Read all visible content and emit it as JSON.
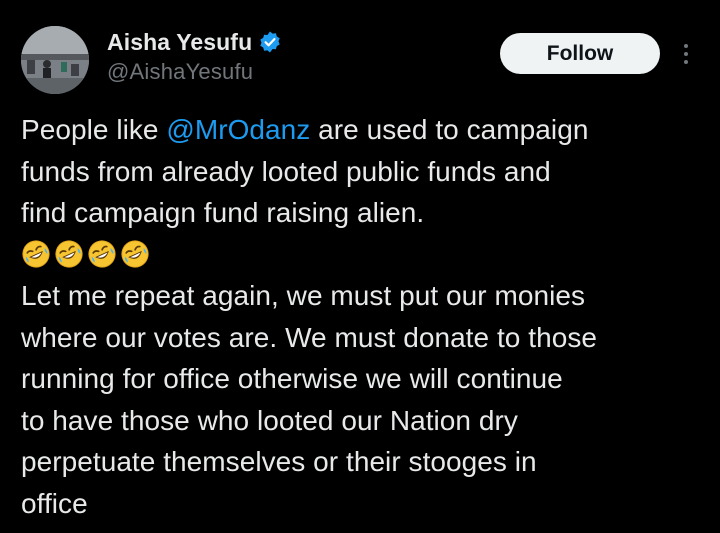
{
  "author": {
    "display_name": "Aisha Yesufu",
    "handle": "@AishaYesufu",
    "verified": true,
    "verified_icon": "verified-badge-icon"
  },
  "actions": {
    "follow_label": "Follow",
    "more_icon": "more-vertical-icon"
  },
  "tweet": {
    "line1_prefix": "People like ",
    "mention": "@MrOdanz",
    "line1_suffix": " are used to campaign",
    "line2": "funds from already looted public funds and",
    "line3": "find campaign fund raising alien.",
    "emoji_name": "rolling-on-the-floor-laughing",
    "emoji_count": 4,
    "line4": "Let me repeat again, we must put our monies",
    "line5": "where our votes are. We must donate to those",
    "line6": "running for office otherwise we will continue",
    "line7": "to have those who looted our Nation dry",
    "line8": "perpetuate themselves or their stooges in",
    "line9": "office"
  },
  "colors": {
    "background": "#000000",
    "text": "#e7e9ea",
    "secondary": "#71767b",
    "link": "#1d9bf0",
    "button_bg": "#eff3f4"
  }
}
